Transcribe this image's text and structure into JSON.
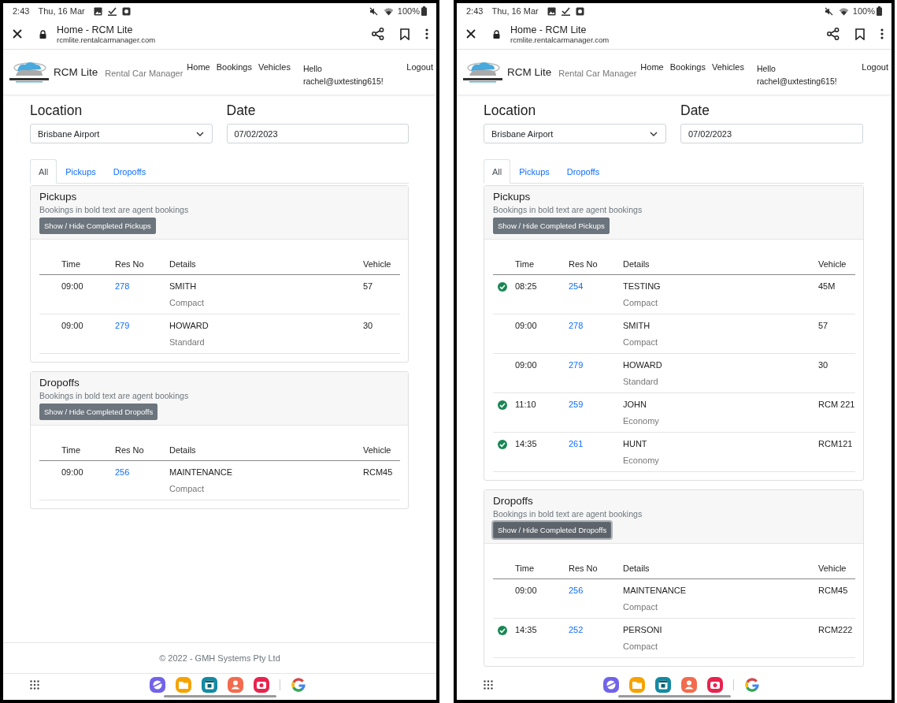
{
  "screens": [
    {
      "status_bar": {
        "time": "2:43",
        "date": "Thu, 16 Mar",
        "battery": "100%"
      },
      "browser": {
        "title": "Home - RCM Lite",
        "url": "rcmlite.rentalcarmanager.com"
      },
      "navbar": {
        "brand": "RCM Lite",
        "tagline": "Rental Car Manager",
        "links": [
          "Home",
          "Bookings",
          "Vehicles"
        ],
        "greeting": "Hello rachel@uxtesting615!",
        "logout": "Logout"
      },
      "filters": {
        "location_label": "Location",
        "location": "Brisbane Airport",
        "date_label": "Date",
        "date": "07/02/2023"
      },
      "tabs": [
        {
          "label": "All",
          "selected": true
        },
        {
          "label": "Pickups",
          "selected": false
        },
        {
          "label": "Dropoffs",
          "selected": false
        }
      ],
      "sections": [
        {
          "title": "Pickups",
          "note": "Bookings in bold text are agent bookings",
          "button": "Show / Hide Completed Pickups",
          "focused": false,
          "columns": [
            "Time",
            "Res No",
            "Details",
            "Vehicle"
          ],
          "rows": [
            {
              "done": false,
              "time": "09:00",
              "res_no": "278",
              "name": "SMITH",
              "category": "Compact",
              "vehicle": "57"
            },
            {
              "done": false,
              "time": "09:00",
              "res_no": "279",
              "name": "HOWARD",
              "category": "Standard",
              "vehicle": "30"
            }
          ]
        },
        {
          "title": "Dropoffs",
          "note": "Bookings in bold text are agent bookings",
          "button": "Show / Hide Completed Dropoffs",
          "focused": false,
          "columns": [
            "Time",
            "Res No",
            "Details",
            "Vehicle"
          ],
          "rows": [
            {
              "done": false,
              "time": "09:00",
              "res_no": "256",
              "name": "MAINTENANCE",
              "category": "Compact",
              "vehicle": "RCM45"
            }
          ]
        }
      ],
      "footer": "© 2022 - GMH Systems Pty Ltd"
    },
    {
      "status_bar": {
        "time": "2:43",
        "date": "Thu, 16 Mar",
        "battery": "100%"
      },
      "browser": {
        "title": "Home - RCM Lite",
        "url": "rcmlite.rentalcarmanager.com"
      },
      "navbar": {
        "brand": "RCM Lite",
        "tagline": "Rental Car Manager",
        "links": [
          "Home",
          "Bookings",
          "Vehicles"
        ],
        "greeting": "Hello rachel@uxtesting615!",
        "logout": "Logout"
      },
      "filters": {
        "location_label": "Location",
        "location": "Brisbane Airport",
        "date_label": "Date",
        "date": "07/02/2023"
      },
      "tabs": [
        {
          "label": "All",
          "selected": true
        },
        {
          "label": "Pickups",
          "selected": false
        },
        {
          "label": "Dropoffs",
          "selected": false
        }
      ],
      "sections": [
        {
          "title": "Pickups",
          "note": "Bookings in bold text are agent bookings",
          "button": "Show / Hide Completed Pickups",
          "focused": false,
          "columns": [
            "Time",
            "Res No",
            "Details",
            "Vehicle"
          ],
          "rows": [
            {
              "done": true,
              "time": "08:25",
              "res_no": "254",
              "name": "TESTING",
              "category": "Compact",
              "vehicle": "45M"
            },
            {
              "done": false,
              "time": "09:00",
              "res_no": "278",
              "name": "SMITH",
              "category": "Compact",
              "vehicle": "57"
            },
            {
              "done": false,
              "time": "09:00",
              "res_no": "279",
              "name": "HOWARD",
              "category": "Standard",
              "vehicle": "30"
            },
            {
              "done": true,
              "time": "11:10",
              "res_no": "259",
              "name": "JOHN",
              "category": "Economy",
              "vehicle": "RCM 221"
            },
            {
              "done": true,
              "time": "14:35",
              "res_no": "261",
              "name": "HUNT",
              "category": "Economy",
              "vehicle": "RCM121"
            }
          ]
        },
        {
          "title": "Dropoffs",
          "note": "Bookings in bold text are agent bookings",
          "button": "Show / Hide Completed Dropoffs",
          "focused": true,
          "columns": [
            "Time",
            "Res No",
            "Details",
            "Vehicle"
          ],
          "rows": [
            {
              "done": false,
              "time": "09:00",
              "res_no": "256",
              "name": "MAINTENANCE",
              "category": "Compact",
              "vehicle": "RCM45"
            },
            {
              "done": true,
              "time": "14:35",
              "res_no": "252",
              "name": "PERSONI",
              "category": "Compact",
              "vehicle": "RCM222"
            }
          ]
        }
      ]
    }
  ]
}
